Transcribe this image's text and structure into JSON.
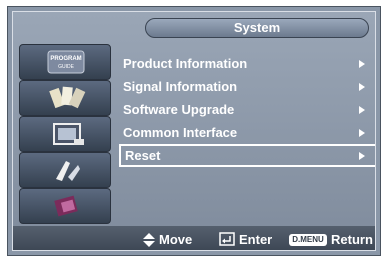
{
  "title": "System",
  "menu": {
    "items": [
      {
        "label": "Product Information"
      },
      {
        "label": "Signal Information"
      },
      {
        "label": "Software Upgrade"
      },
      {
        "label": "Common Interface"
      },
      {
        "label": "Reset"
      }
    ],
    "selected_index": 4
  },
  "sidebar": {
    "items": [
      {
        "icon": "program-guide-icon",
        "text": "PROGRAM GUIDE"
      },
      {
        "icon": "channel-icon"
      },
      {
        "icon": "picture-icon"
      },
      {
        "icon": "sound-icon"
      },
      {
        "icon": "setup-icon"
      }
    ]
  },
  "footer": {
    "move_label": "Move",
    "enter_label": "Enter",
    "menu_key_label": "D.MENU",
    "return_label": "Return"
  },
  "colors": {
    "panel": "#8a97a8",
    "selection_border": "#ffffff",
    "text": "#ffffff"
  }
}
